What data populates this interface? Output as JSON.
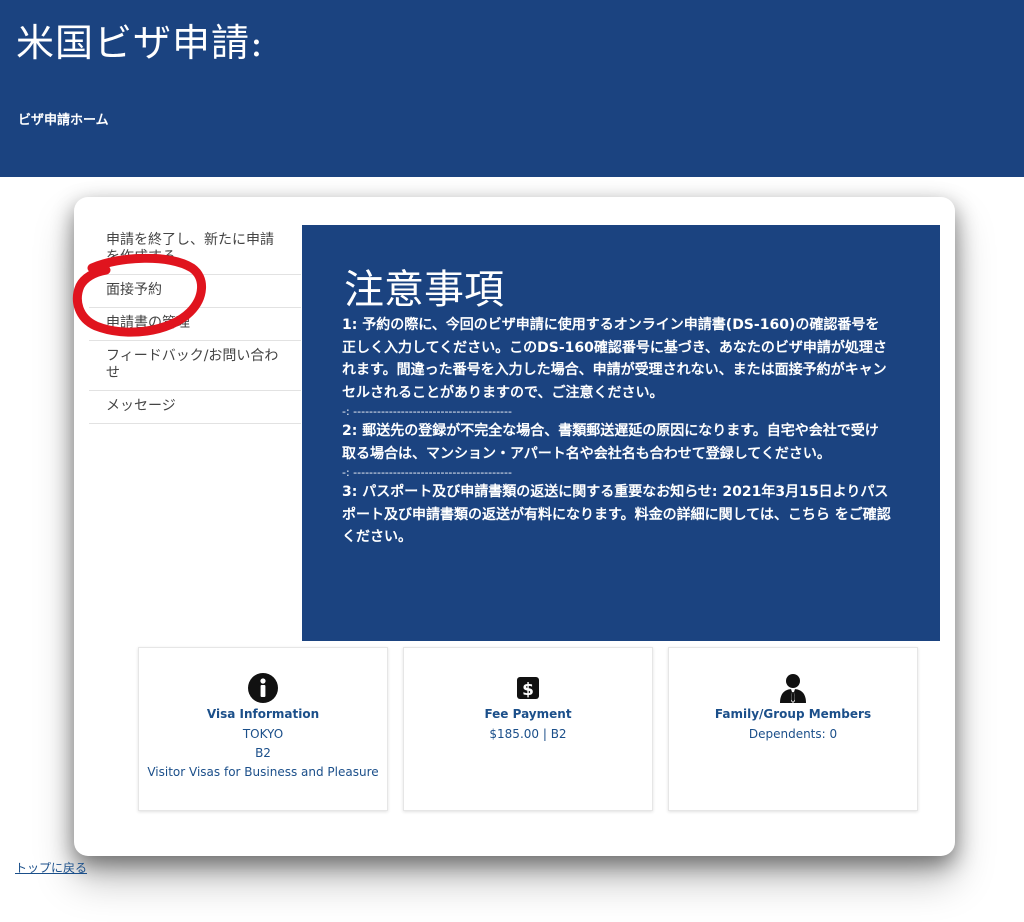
{
  "header": {
    "site_title": "米国ビザ申請:",
    "nav_home": "ビザ申請ホーム"
  },
  "sidebar": {
    "items": [
      {
        "label": "申請を終了し、新たに申請を作成する"
      },
      {
        "label": "面接予約"
      },
      {
        "label": "申請書の管理"
      },
      {
        "label": "フィードバック/お問い合わせ"
      },
      {
        "label": "メッセージ"
      }
    ]
  },
  "notice": {
    "title": "注意事項",
    "item1": "1: 予約の際に、今回のビザ申請に使用するオンライン申請書(DS-160)の確認番号を正しく入力してください。このDS-160確認番号に基づき、あなたのビザ申請が処理されます。間違った番号を入力した場合、申請が受理されない、または面接予約がキャンセルされることがありますので、ご注意ください。",
    "sep1": "-: ----------------------------------------",
    "item2": "2: 郵送先の登録が不完全な場合、書類郵送遅延の原因になります。自宅や会社で受け取る場合は、マンション・アパート名や会社名も合わせて登録してください。",
    "sep2": "-: ----------------------------------------",
    "item3": "3: パスポート及び申請書類の返送に関する重要なお知らせ: 2021年3月15日よりパスポート及び申請書類の返送が有料になります。料金の詳細に関しては、こちら をご確認ください。"
  },
  "tiles": {
    "visa": {
      "icon": "info-icon",
      "title": "Visa Information",
      "line1": "TOKYO",
      "line2": "B2",
      "line3": "Visitor Visas for Business and Pleasure"
    },
    "fee": {
      "icon": "dollar-icon",
      "title": "Fee Payment",
      "line1": "$185.00 | B2"
    },
    "family": {
      "icon": "person-icon",
      "title": "Family/Group Members",
      "line1": "Dependents: 0"
    }
  },
  "footer": {
    "back_to_top": "トップに戻る"
  },
  "colors": {
    "brand_navy": "#1b4380",
    "link_blue": "#1b4f8a",
    "annotation_red": "#e0141e"
  }
}
